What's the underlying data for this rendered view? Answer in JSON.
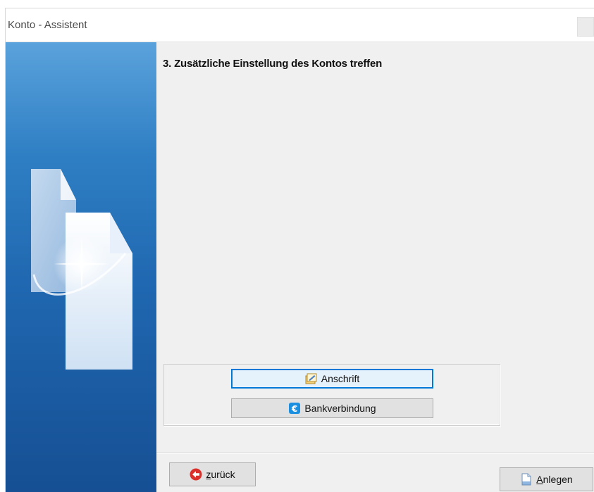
{
  "window": {
    "title": "Konto - Assistent"
  },
  "wizard": {
    "step_title": "3. Zusätzliche Einstellung des Kontos treffen"
  },
  "options": {
    "address_button": {
      "label": "Anschrift",
      "icon": "address-card-icon"
    },
    "bank_button": {
      "label": "Bankverbindung",
      "icon": "euro-icon"
    }
  },
  "navigation": {
    "back_button": {
      "mnemonic": "z",
      "rest": "urück",
      "icon": "back-arrow-icon"
    },
    "create_button": {
      "mnemonic": "A",
      "rest": "nlegen",
      "icon": "document-icon"
    }
  },
  "colors": {
    "focus": "#0078d7",
    "side_panel_top": "#5aa2dc",
    "side_panel_bottom": "#164f93",
    "back_icon": "#d9302c",
    "euro_icon": "#1b8fe0"
  }
}
